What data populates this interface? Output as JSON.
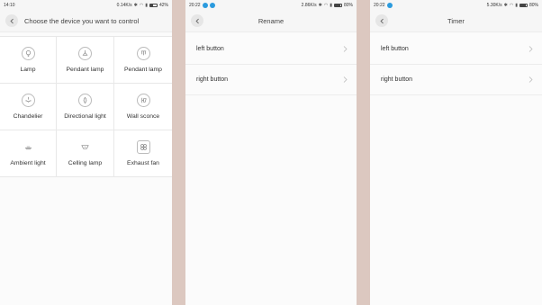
{
  "screens": [
    {
      "status": {
        "time": "14:10",
        "speed": "0.14K/s",
        "battery": "42%",
        "battery_level": 0.42
      },
      "title": "Choose the device you want to control",
      "devices": [
        {
          "label": "Lamp",
          "icon": "lamp-icon"
        },
        {
          "label": "Pendant lamp",
          "icon": "pendant-lamp-icon"
        },
        {
          "label": "Pendant lamp",
          "icon": "pendant-lamp-icon"
        },
        {
          "label": "Chandelier",
          "icon": "chandelier-icon"
        },
        {
          "label": "Directional light",
          "icon": "directional-light-icon"
        },
        {
          "label": "Wall sconce",
          "icon": "wall-sconce-icon"
        },
        {
          "label": "Ambient light",
          "icon": "ambient-light-icon"
        },
        {
          "label": "Celling lamp",
          "icon": "ceiling-lamp-icon"
        },
        {
          "label": "Exhaust fan",
          "icon": "exhaust-fan-icon"
        }
      ]
    },
    {
      "status": {
        "time": "20:22",
        "speed": "2.86K/s",
        "battery": "80%",
        "battery_level": 0.8
      },
      "title": "Rename",
      "items": [
        "left button",
        "right button"
      ]
    },
    {
      "status": {
        "time": "20:22",
        "speed": "5.30K/s",
        "battery": "80%",
        "battery_level": 0.8
      },
      "title": "Timer",
      "items": [
        "left button",
        "right button"
      ]
    }
  ],
  "colors": {
    "backdrop": "#dcc8c0",
    "screen_bg": "#fbfbfb",
    "divider": "#ececec",
    "badge": "#2b9bde"
  }
}
